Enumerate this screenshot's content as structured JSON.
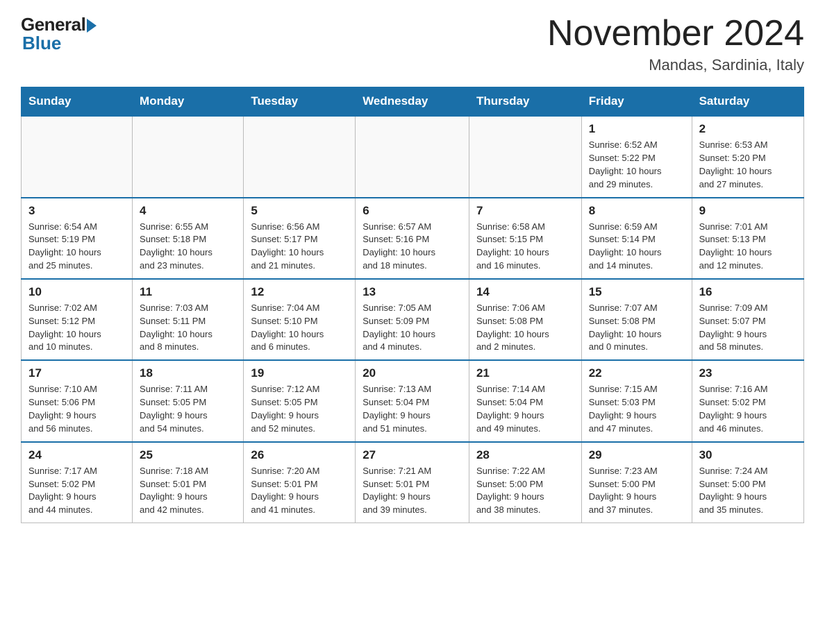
{
  "header": {
    "logo": {
      "general": "General",
      "blue": "Blue"
    },
    "title": "November 2024",
    "location": "Mandas, Sardinia, Italy"
  },
  "days_of_week": [
    "Sunday",
    "Monday",
    "Tuesday",
    "Wednesday",
    "Thursday",
    "Friday",
    "Saturday"
  ],
  "weeks": [
    [
      {
        "day": "",
        "info": ""
      },
      {
        "day": "",
        "info": ""
      },
      {
        "day": "",
        "info": ""
      },
      {
        "day": "",
        "info": ""
      },
      {
        "day": "",
        "info": ""
      },
      {
        "day": "1",
        "info": "Sunrise: 6:52 AM\nSunset: 5:22 PM\nDaylight: 10 hours\nand 29 minutes."
      },
      {
        "day": "2",
        "info": "Sunrise: 6:53 AM\nSunset: 5:20 PM\nDaylight: 10 hours\nand 27 minutes."
      }
    ],
    [
      {
        "day": "3",
        "info": "Sunrise: 6:54 AM\nSunset: 5:19 PM\nDaylight: 10 hours\nand 25 minutes."
      },
      {
        "day": "4",
        "info": "Sunrise: 6:55 AM\nSunset: 5:18 PM\nDaylight: 10 hours\nand 23 minutes."
      },
      {
        "day": "5",
        "info": "Sunrise: 6:56 AM\nSunset: 5:17 PM\nDaylight: 10 hours\nand 21 minutes."
      },
      {
        "day": "6",
        "info": "Sunrise: 6:57 AM\nSunset: 5:16 PM\nDaylight: 10 hours\nand 18 minutes."
      },
      {
        "day": "7",
        "info": "Sunrise: 6:58 AM\nSunset: 5:15 PM\nDaylight: 10 hours\nand 16 minutes."
      },
      {
        "day": "8",
        "info": "Sunrise: 6:59 AM\nSunset: 5:14 PM\nDaylight: 10 hours\nand 14 minutes."
      },
      {
        "day": "9",
        "info": "Sunrise: 7:01 AM\nSunset: 5:13 PM\nDaylight: 10 hours\nand 12 minutes."
      }
    ],
    [
      {
        "day": "10",
        "info": "Sunrise: 7:02 AM\nSunset: 5:12 PM\nDaylight: 10 hours\nand 10 minutes."
      },
      {
        "day": "11",
        "info": "Sunrise: 7:03 AM\nSunset: 5:11 PM\nDaylight: 10 hours\nand 8 minutes."
      },
      {
        "day": "12",
        "info": "Sunrise: 7:04 AM\nSunset: 5:10 PM\nDaylight: 10 hours\nand 6 minutes."
      },
      {
        "day": "13",
        "info": "Sunrise: 7:05 AM\nSunset: 5:09 PM\nDaylight: 10 hours\nand 4 minutes."
      },
      {
        "day": "14",
        "info": "Sunrise: 7:06 AM\nSunset: 5:08 PM\nDaylight: 10 hours\nand 2 minutes."
      },
      {
        "day": "15",
        "info": "Sunrise: 7:07 AM\nSunset: 5:08 PM\nDaylight: 10 hours\nand 0 minutes."
      },
      {
        "day": "16",
        "info": "Sunrise: 7:09 AM\nSunset: 5:07 PM\nDaylight: 9 hours\nand 58 minutes."
      }
    ],
    [
      {
        "day": "17",
        "info": "Sunrise: 7:10 AM\nSunset: 5:06 PM\nDaylight: 9 hours\nand 56 minutes."
      },
      {
        "day": "18",
        "info": "Sunrise: 7:11 AM\nSunset: 5:05 PM\nDaylight: 9 hours\nand 54 minutes."
      },
      {
        "day": "19",
        "info": "Sunrise: 7:12 AM\nSunset: 5:05 PM\nDaylight: 9 hours\nand 52 minutes."
      },
      {
        "day": "20",
        "info": "Sunrise: 7:13 AM\nSunset: 5:04 PM\nDaylight: 9 hours\nand 51 minutes."
      },
      {
        "day": "21",
        "info": "Sunrise: 7:14 AM\nSunset: 5:04 PM\nDaylight: 9 hours\nand 49 minutes."
      },
      {
        "day": "22",
        "info": "Sunrise: 7:15 AM\nSunset: 5:03 PM\nDaylight: 9 hours\nand 47 minutes."
      },
      {
        "day": "23",
        "info": "Sunrise: 7:16 AM\nSunset: 5:02 PM\nDaylight: 9 hours\nand 46 minutes."
      }
    ],
    [
      {
        "day": "24",
        "info": "Sunrise: 7:17 AM\nSunset: 5:02 PM\nDaylight: 9 hours\nand 44 minutes."
      },
      {
        "day": "25",
        "info": "Sunrise: 7:18 AM\nSunset: 5:01 PM\nDaylight: 9 hours\nand 42 minutes."
      },
      {
        "day": "26",
        "info": "Sunrise: 7:20 AM\nSunset: 5:01 PM\nDaylight: 9 hours\nand 41 minutes."
      },
      {
        "day": "27",
        "info": "Sunrise: 7:21 AM\nSunset: 5:01 PM\nDaylight: 9 hours\nand 39 minutes."
      },
      {
        "day": "28",
        "info": "Sunrise: 7:22 AM\nSunset: 5:00 PM\nDaylight: 9 hours\nand 38 minutes."
      },
      {
        "day": "29",
        "info": "Sunrise: 7:23 AM\nSunset: 5:00 PM\nDaylight: 9 hours\nand 37 minutes."
      },
      {
        "day": "30",
        "info": "Sunrise: 7:24 AM\nSunset: 5:00 PM\nDaylight: 9 hours\nand 35 minutes."
      }
    ]
  ]
}
